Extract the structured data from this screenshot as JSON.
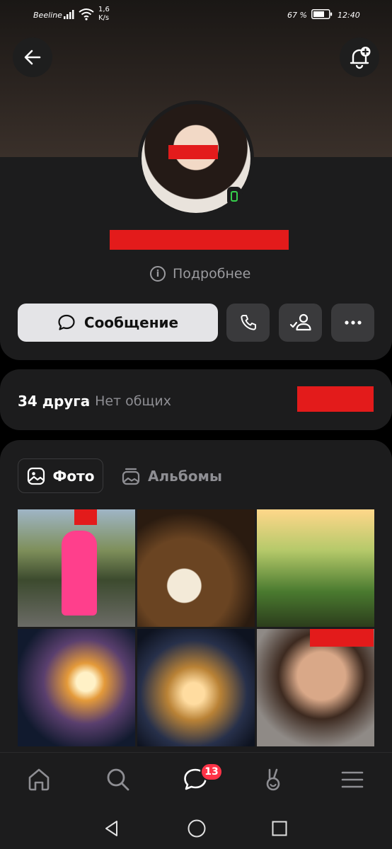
{
  "status_bar": {
    "carrier": "Beeline",
    "speed_value": "1,6",
    "speed_unit": "K/s",
    "battery_percent": "67 %",
    "time": "12:40"
  },
  "profile": {
    "details_label": "Подробнее",
    "message_button": "Сообщение"
  },
  "friends": {
    "count_label": "34 друга",
    "mutual_label": "· Нет общих"
  },
  "photos": {
    "tabs": [
      {
        "label": "Фото",
        "active": true
      },
      {
        "label": "Альбомы",
        "active": false
      }
    ]
  },
  "bottom_nav": {
    "messages_badge": "13"
  },
  "colors": {
    "accent_red": "#ff3347",
    "online_green": "#36d04c",
    "card_bg": "#1c1c1d",
    "button_light": "#e4e4e7"
  }
}
